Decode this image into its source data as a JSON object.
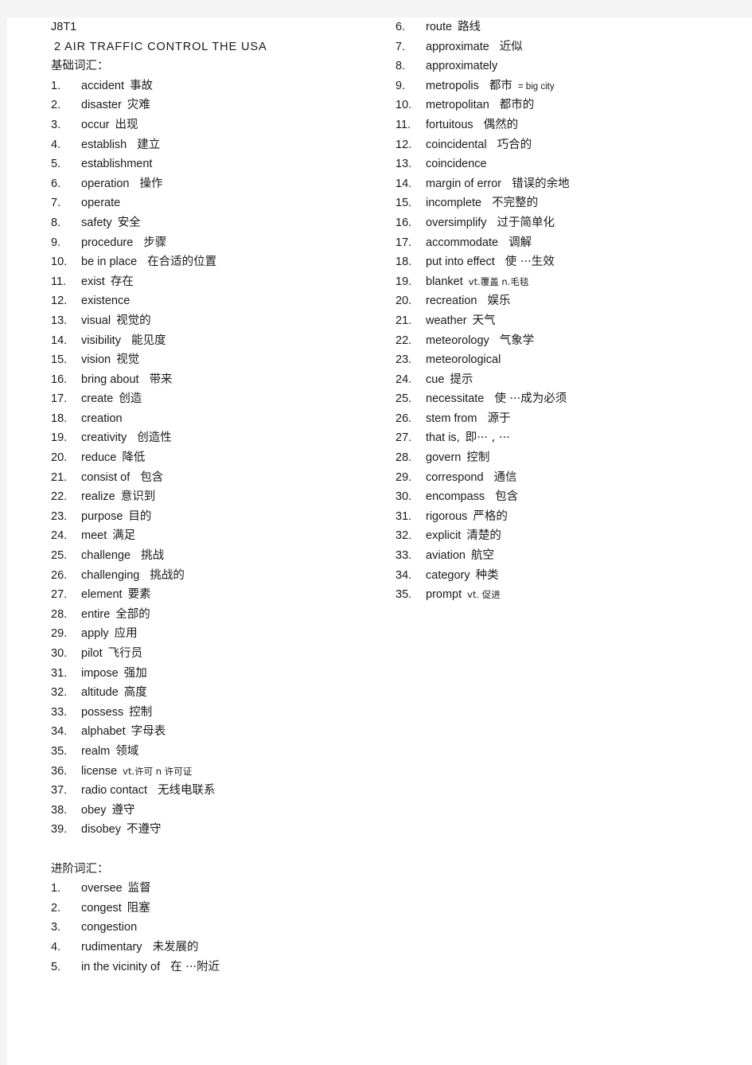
{
  "document": {
    "doc_id": "J8T1",
    "title": "2 AIR TRAFFIC CONTROL THE USA"
  },
  "sections": [
    {
      "heading": "基础词汇：",
      "items": [
        {
          "num": "1.",
          "word": "accident",
          "gloss": "事故"
        },
        {
          "num": "2.",
          "word": "disaster",
          "gloss": "灾难"
        },
        {
          "num": "3.",
          "word": "occur",
          "gloss": "出现"
        },
        {
          "num": "4.",
          "word": "establish",
          "gloss": "建立"
        },
        {
          "num": "5.",
          "word": "establishment",
          "gloss": ""
        },
        {
          "num": "6.",
          "word": "operation",
          "gloss": "操作"
        },
        {
          "num": "7.",
          "word": "operate",
          "gloss": ""
        },
        {
          "num": "8.",
          "word": "safety",
          "gloss": "安全"
        },
        {
          "num": "9.",
          "word": "procedure",
          "gloss": "步骤"
        },
        {
          "num": "10.",
          "word": "be in place",
          "gloss": "在合适的位置"
        },
        {
          "num": "11.",
          "word": "exist",
          "gloss": "存在"
        },
        {
          "num": "12.",
          "word": "existence",
          "gloss": ""
        },
        {
          "num": "13.",
          "word": "visual",
          "gloss": "视觉的"
        },
        {
          "num": "14.",
          "word": "visibility",
          "gloss": "能见度"
        },
        {
          "num": "15.",
          "word": "vision",
          "gloss": "视觉"
        },
        {
          "num": "16.",
          "word": "bring about",
          "gloss": "带来"
        },
        {
          "num": "17.",
          "word": "create",
          "gloss": "创造"
        },
        {
          "num": "18.",
          "word": "creation",
          "gloss": ""
        },
        {
          "num": "19.",
          "word": "creativity",
          "gloss": "创造性"
        },
        {
          "num": "20.",
          "word": "reduce",
          "gloss": "降低"
        },
        {
          "num": "21.",
          "word": "consist of",
          "gloss": "包含"
        },
        {
          "num": "22.",
          "word": "realize",
          "gloss": "意识到"
        },
        {
          "num": "23.",
          "word": "purpose",
          "gloss": "目的"
        },
        {
          "num": "24.",
          "word": "meet",
          "gloss": "满足"
        },
        {
          "num": "25.",
          "word": "challenge",
          "gloss": "挑战"
        },
        {
          "num": "26.",
          "word": "challenging",
          "gloss": "挑战的"
        },
        {
          "num": "27.",
          "word": "element",
          "gloss": "要素"
        },
        {
          "num": "28.",
          "word": "entire",
          "gloss": "全部的"
        },
        {
          "num": "29.",
          "word": "apply",
          "gloss": "应用"
        },
        {
          "num": "30.",
          "word": "pilot",
          "gloss": "飞行员"
        },
        {
          "num": "31.",
          "word": "impose",
          "gloss": "强加"
        },
        {
          "num": "32.",
          "word": "altitude",
          "gloss": "高度"
        },
        {
          "num": "33.",
          "word": "possess",
          "gloss": "控制"
        },
        {
          "num": "34.",
          "word": "alphabet",
          "gloss": "字母表"
        },
        {
          "num": "35.",
          "word": "realm",
          "gloss": "领域"
        },
        {
          "num": "36.",
          "word": "license",
          "gloss": "",
          "gloss_small": "vt.许可   n 许可证"
        },
        {
          "num": "37.",
          "word": "radio contact",
          "gloss": "无线电联系"
        },
        {
          "num": "38.",
          "word": "obey",
          "gloss": "遵守"
        },
        {
          "num": "39.",
          "word": "disobey",
          "gloss": "不遵守"
        }
      ]
    },
    {
      "heading": "进阶词汇：",
      "items": [
        {
          "num": "1.",
          "word": "oversee",
          "gloss": "监督"
        },
        {
          "num": "2.",
          "word": "congest",
          "gloss": "阻塞"
        },
        {
          "num": "3.",
          "word": "congestion",
          "gloss": ""
        },
        {
          "num": "4.",
          "word": "rudimentary",
          "gloss": "未发展的"
        },
        {
          "num": "5.",
          "word": "in the vicinity of",
          "gloss": "在 ···附近"
        },
        {
          "num": "6.",
          "word": "route",
          "gloss": "路线"
        },
        {
          "num": "7.",
          "word": "approximate",
          "gloss": "近似"
        },
        {
          "num": "8.",
          "word": "approximately",
          "gloss": ""
        },
        {
          "num": "9.",
          "word": "metropolis",
          "gloss": "都市",
          "gloss_small": "= big city"
        },
        {
          "num": "10.",
          "word": "metropolitan",
          "gloss": "都市的"
        },
        {
          "num": "11.",
          "word": "fortuitous",
          "gloss": "偶然的"
        },
        {
          "num": "12.",
          "word": "coincidental",
          "gloss": "巧合的"
        },
        {
          "num": "13.",
          "word": "coincidence",
          "gloss": ""
        },
        {
          "num": "14.",
          "word": "margin of error",
          "gloss": "错误的余地"
        },
        {
          "num": "15.",
          "word": "incomplete",
          "gloss": "不完整的"
        },
        {
          "num": "16.",
          "word": "oversimplify",
          "gloss": "过于简单化"
        },
        {
          "num": "17.",
          "word": "accommodate",
          "gloss": "调解"
        },
        {
          "num": "18.",
          "word": "put into effect",
          "gloss": "使 ···生效"
        },
        {
          "num": "19.",
          "word": "blanket",
          "gloss": "",
          "gloss_small": "vt.覆盖  n.毛毯"
        },
        {
          "num": "20.",
          "word": "recreation",
          "gloss": "娱乐"
        },
        {
          "num": "21.",
          "word": "weather",
          "gloss": "天气"
        },
        {
          "num": "22.",
          "word": "meteorology",
          "gloss": "气象学"
        },
        {
          "num": "23.",
          "word": "meteorological",
          "gloss": ""
        },
        {
          "num": "24.",
          "word": "cue",
          "gloss": "提示"
        },
        {
          "num": "25.",
          "word": "necessitate",
          "gloss": "使 ···成为必须"
        },
        {
          "num": "26.",
          "word": "stem from",
          "gloss": "源于"
        },
        {
          "num": "27.",
          "word": "that is,",
          "gloss": "即··· , ···"
        },
        {
          "num": "28.",
          "word": "govern",
          "gloss": "控制"
        },
        {
          "num": "29.",
          "word": "correspond",
          "gloss": "通信"
        },
        {
          "num": "30.",
          "word": "encompass",
          "gloss": "包含"
        },
        {
          "num": "31.",
          "word": "rigorous",
          "gloss": "严格的"
        },
        {
          "num": "32.",
          "word": "explicit",
          "gloss": "清楚的"
        },
        {
          "num": "33.",
          "word": "aviation",
          "gloss": "航空"
        },
        {
          "num": "34.",
          "word": "category",
          "gloss": "种类"
        },
        {
          "num": "35.",
          "word": "prompt",
          "gloss": "",
          "gloss_small": "vt.  促进"
        }
      ]
    }
  ],
  "layout": {
    "left_column_start_index": 0,
    "left_column_advanced_count": 5,
    "right_column_advanced_start": 5
  }
}
